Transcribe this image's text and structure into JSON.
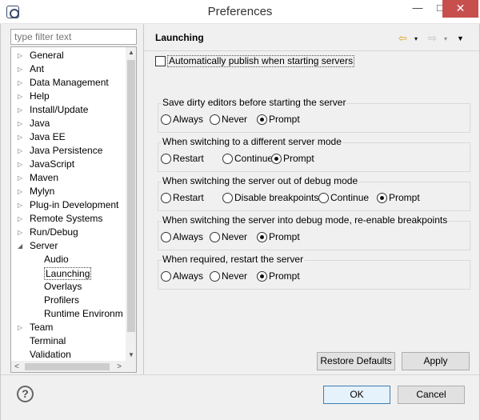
{
  "window": {
    "title": "Preferences",
    "min_glyph": "—",
    "max_glyph": "□",
    "close_glyph": "✕"
  },
  "filter": {
    "placeholder": "type filter text"
  },
  "tree": {
    "items": [
      {
        "label": "General",
        "expand": "▷"
      },
      {
        "label": "Ant",
        "expand": "▷"
      },
      {
        "label": "Data Management",
        "expand": "▷"
      },
      {
        "label": "Help",
        "expand": "▷"
      },
      {
        "label": "Install/Update",
        "expand": "▷"
      },
      {
        "label": "Java",
        "expand": "▷"
      },
      {
        "label": "Java EE",
        "expand": "▷"
      },
      {
        "label": "Java Persistence",
        "expand": "▷"
      },
      {
        "label": "JavaScript",
        "expand": "▷"
      },
      {
        "label": "Maven",
        "expand": "▷"
      },
      {
        "label": "Mylyn",
        "expand": "▷"
      },
      {
        "label": "Plug-in Development",
        "expand": "▷"
      },
      {
        "label": "Remote Systems",
        "expand": "▷"
      },
      {
        "label": "Run/Debug",
        "expand": "▷"
      },
      {
        "label": "Server",
        "expand": "◢"
      },
      {
        "label": "Audio",
        "expand": ""
      },
      {
        "label": "Launching",
        "expand": ""
      },
      {
        "label": "Overlays",
        "expand": ""
      },
      {
        "label": "Profilers",
        "expand": ""
      },
      {
        "label": "Runtime Environm",
        "expand": ""
      },
      {
        "label": "Team",
        "expand": "▷"
      },
      {
        "label": "Terminal",
        "expand": ""
      },
      {
        "label": "Validation",
        "expand": ""
      }
    ],
    "selected": "Launching",
    "scroll_up": "▲",
    "scroll_down": "▼",
    "scroll_left": "<",
    "scroll_right": ">"
  },
  "page": {
    "title": "Launching",
    "auto_publish": {
      "label": "Automatically publish when starting servers",
      "checked": false
    },
    "groups": [
      {
        "title": "Save dirty editors before starting the server",
        "options": [
          "Always",
          "Never",
          "Prompt"
        ],
        "selected": "Prompt"
      },
      {
        "title": "When switching to a different server mode",
        "options": [
          "Restart",
          "Continue",
          "Prompt"
        ],
        "selected": "Prompt"
      },
      {
        "title": "When switching the server out of debug mode",
        "options": [
          "Restart",
          "Disable breakpoints",
          "Continue",
          "Prompt"
        ],
        "selected": "Prompt"
      },
      {
        "title": "When switching the server into debug mode, re-enable breakpoints",
        "options": [
          "Always",
          "Never",
          "Prompt"
        ],
        "selected": "Prompt"
      },
      {
        "title": "When required, restart the server",
        "options": [
          "Always",
          "Never",
          "Prompt"
        ],
        "selected": "Prompt"
      }
    ],
    "restore_defaults": "Restore Defaults",
    "apply": "Apply",
    "nav_back": "⇦",
    "nav_forward": "⇨",
    "nav_dropdown": "▾",
    "view_menu": "▼"
  },
  "footer": {
    "help": "?",
    "ok": "OK",
    "cancel": "Cancel"
  },
  "colors": {
    "close_button": "#c7504d",
    "back_arrow": "#e3a21a",
    "default_button_border": "#3c7fb1"
  }
}
